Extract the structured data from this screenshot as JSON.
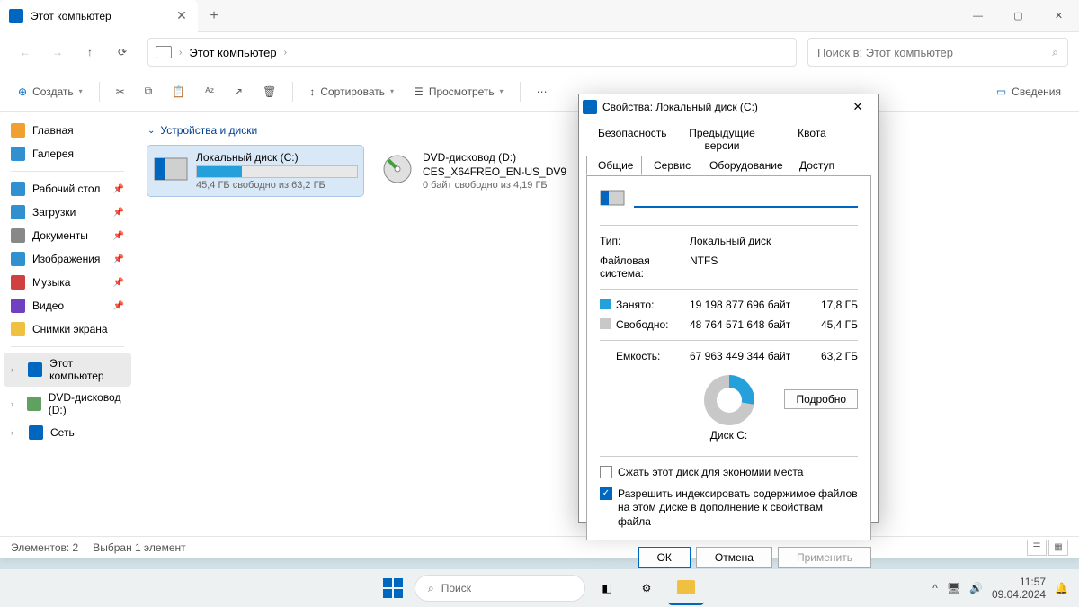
{
  "tab": {
    "title": "Этот компьютер"
  },
  "nav": {
    "location": "Этот компьютер"
  },
  "search": {
    "placeholder": "Поиск в: Этот компьютер"
  },
  "toolbar": {
    "create": "Создать",
    "sort": "Сортировать",
    "view": "Просмотреть",
    "details": "Сведения"
  },
  "sidebar": {
    "home": "Главная",
    "gallery": "Галерея",
    "desktop": "Рабочий стол",
    "downloads": "Загрузки",
    "documents": "Документы",
    "pictures": "Изображения",
    "music": "Музыка",
    "videos": "Видео",
    "screenshots": "Снимки экрана",
    "thispc": "Этот компьютер",
    "dvd": "DVD-дисковод (D:)",
    "network": "Сеть"
  },
  "content": {
    "group": "Устройства и диски",
    "drive_c": {
      "name": "Локальный диск (C:)",
      "free": "45,4 ГБ свободно из 63,2 ГБ",
      "fill_pct": 28
    },
    "drive_d": {
      "name": "DVD-дисковод (D:)",
      "sub": "CES_X64FREO_EN-US_DV9",
      "free": "0 байт свободно из 4,19 ГБ"
    }
  },
  "statusbar": {
    "items": "Элементов: 2",
    "selected": "Выбран 1 элемент"
  },
  "dialog": {
    "title": "Свойства: Локальный диск (C:)",
    "tabs": {
      "security": "Безопасность",
      "prev": "Предыдущие версии",
      "quota": "Квота",
      "general": "Общие",
      "service": "Сервис",
      "hardware": "Оборудование",
      "access": "Доступ"
    },
    "type_label": "Тип:",
    "type_val": "Локальный диск",
    "fs_label": "Файловая система:",
    "fs_val": "NTFS",
    "used_label": "Занято:",
    "used_bytes": "19 198 877 696 байт",
    "used_gb": "17,8 ГБ",
    "free_label": "Свободно:",
    "free_bytes": "48 764 571 648 байт",
    "free_gb": "45,4 ГБ",
    "cap_label": "Емкость:",
    "cap_bytes": "67 963 449 344 байт",
    "cap_gb": "63,2 ГБ",
    "disk_label": "Диск C:",
    "details_btn": "Подробно",
    "compress": "Сжать этот диск для экономии места",
    "index": "Разрешить индексировать содержимое файлов на этом диске в дополнение к свойствам файла",
    "ok": "ОК",
    "cancel": "Отмена",
    "apply": "Применить"
  },
  "taskbar": {
    "search": "Поиск",
    "time": "11:57",
    "date": "09.04.2024"
  },
  "chart_data": {
    "type": "pie",
    "title": "Диск C:",
    "series": [
      {
        "name": "Занято",
        "value": 19198877696,
        "display": "17,8 ГБ",
        "color": "#26a0da"
      },
      {
        "name": "Свободно",
        "value": 48764571648,
        "display": "45,4 ГБ",
        "color": "#c8c8c8"
      }
    ],
    "total": {
      "label": "Емкость",
      "value": 67963449344,
      "display": "63,2 ГБ"
    }
  }
}
